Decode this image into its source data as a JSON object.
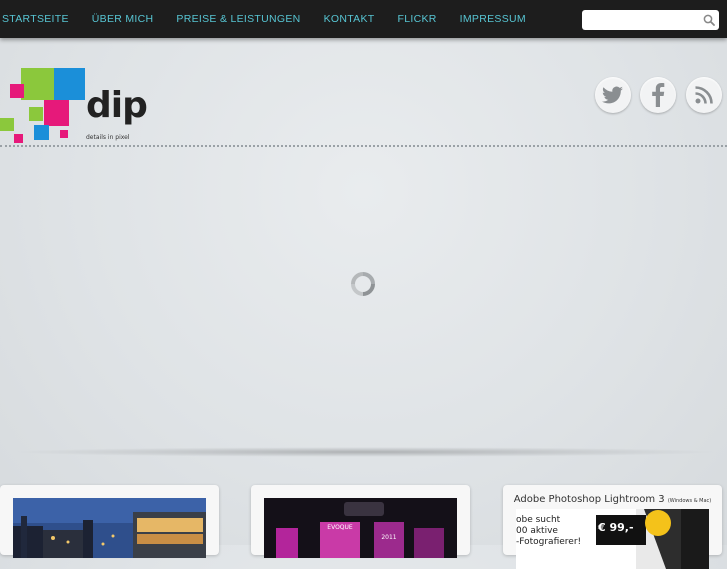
{
  "nav": {
    "items": [
      "STARTSEITE",
      "ÜBER MICH",
      "PREISE & LEISTUNGEN",
      "KONTAKT",
      "FLICKR",
      "IMPRESSUM"
    ]
  },
  "search": {
    "placeholder": ""
  },
  "logo": {
    "word": "dip",
    "tagline": "details in pixel"
  },
  "social": [
    "twitter-icon",
    "facebook-icon",
    "rss-icon"
  ],
  "cards": {
    "third": {
      "title": "Adobe Photoshop Lightroom 3",
      "title_suffix": "(Windows & Mac)",
      "line1": "obe sucht",
      "line2": "00 aktive",
      "line3": "-Fotografierer!",
      "price": "€ 99,-"
    },
    "second": {
      "label1": "EVOQUE",
      "label2": "2011"
    }
  },
  "colors": {
    "accent": "#57c5d3",
    "nav_bg": "#1d1d1d"
  }
}
